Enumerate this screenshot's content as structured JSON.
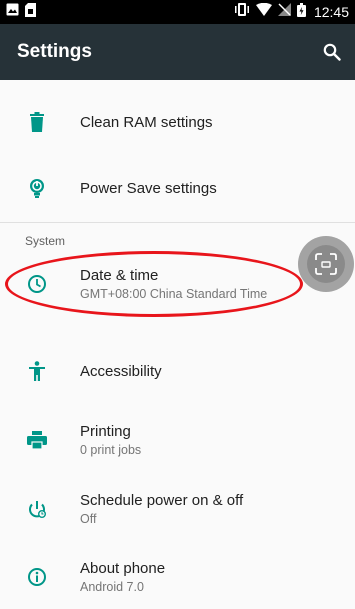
{
  "status_bar": {
    "time": "12:45",
    "icons": [
      "image-icon",
      "sim-icon",
      "vibrate-icon",
      "wifi-icon",
      "no-sim-icon",
      "battery-icon"
    ]
  },
  "app_bar": {
    "title": "Settings",
    "search_icon": "search-icon"
  },
  "settings": {
    "items_top": [
      {
        "title": "Clean RAM settings",
        "icon": "trash-icon"
      },
      {
        "title": "Power Save settings",
        "icon": "power-save-icon"
      }
    ],
    "section": "System",
    "items_system": [
      {
        "title": "Date & time",
        "summary": "GMT+08:00 China Standard Time",
        "icon": "clock-icon"
      },
      {
        "title": "Accessibility",
        "icon": "accessibility-icon"
      },
      {
        "title": "Printing",
        "summary": "0 print jobs",
        "icon": "print-icon"
      },
      {
        "title": "Schedule power on & off",
        "summary": "Off",
        "icon": "schedule-power-icon"
      },
      {
        "title": "About phone",
        "summary": "Android 7.0",
        "icon": "info-icon"
      }
    ]
  },
  "colors": {
    "app_bar": "#263238",
    "accent": "#009688",
    "highlight": "#e8151b"
  }
}
